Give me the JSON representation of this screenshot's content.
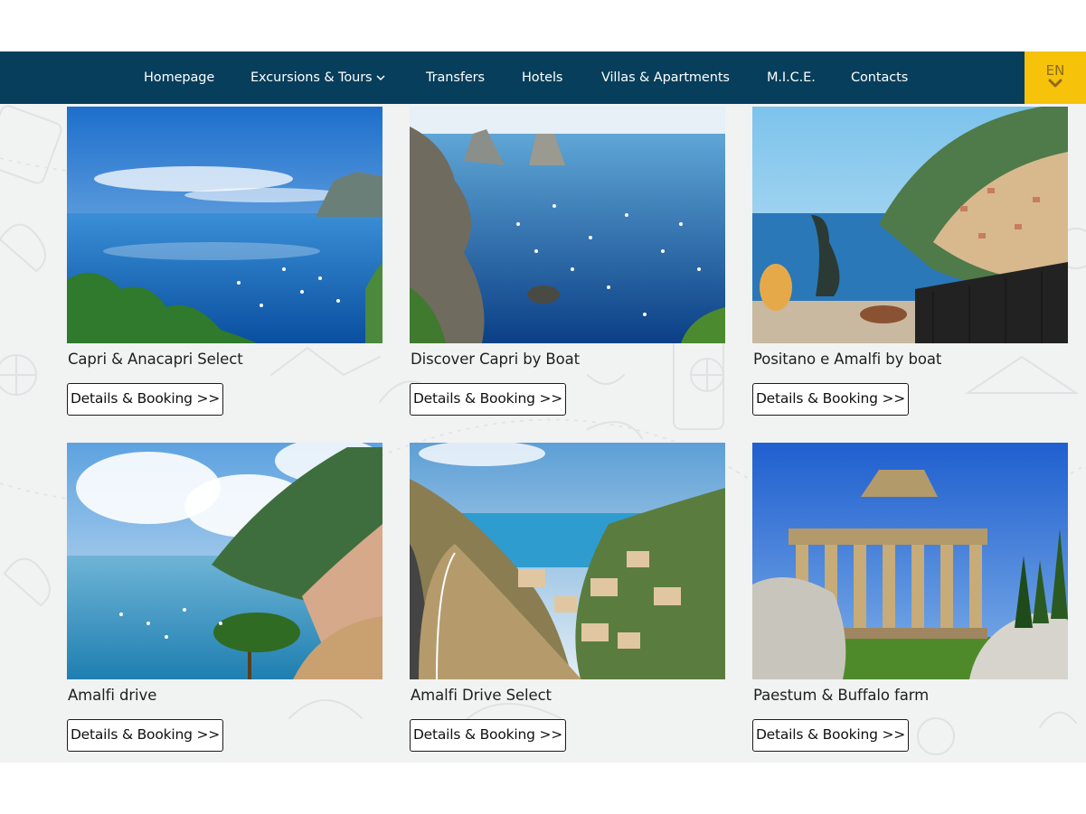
{
  "nav": {
    "items": [
      {
        "label": "Homepage"
      },
      {
        "label": "Excursions & Tours"
      },
      {
        "label": "Transfers"
      },
      {
        "label": "Hotels"
      },
      {
        "label": "Villas & Apartments"
      },
      {
        "label": "M.I.C.E."
      },
      {
        "label": "Contacts"
      }
    ],
    "language": "EN"
  },
  "colors": {
    "nav_bg": "#063e5b",
    "lang_bg": "#f6c20a",
    "content_bg": "#f1f2f2"
  },
  "cards": [
    {
      "title": "Capri & Anacapri Select",
      "button": "Details & Booking >>",
      "image": "capri-coast-photo"
    },
    {
      "title": "Discover Capri by Boat",
      "button": "Details & Booking >>",
      "image": "faraglioni-boats-photo"
    },
    {
      "title": "Positano e Amalfi by boat",
      "button": "Details & Booking >>",
      "image": "positano-terrace-photo"
    },
    {
      "title": "Amalfi drive",
      "button": "Details & Booking >>",
      "image": "amalfi-coast-pine-photo"
    },
    {
      "title": "Amalfi Drive Select",
      "button": "Details & Booking >>",
      "image": "amalfi-road-village-photo"
    },
    {
      "title": "Paestum & Buffalo farm",
      "button": "Details & Booking >>",
      "image": "paestum-temple-photo"
    }
  ]
}
